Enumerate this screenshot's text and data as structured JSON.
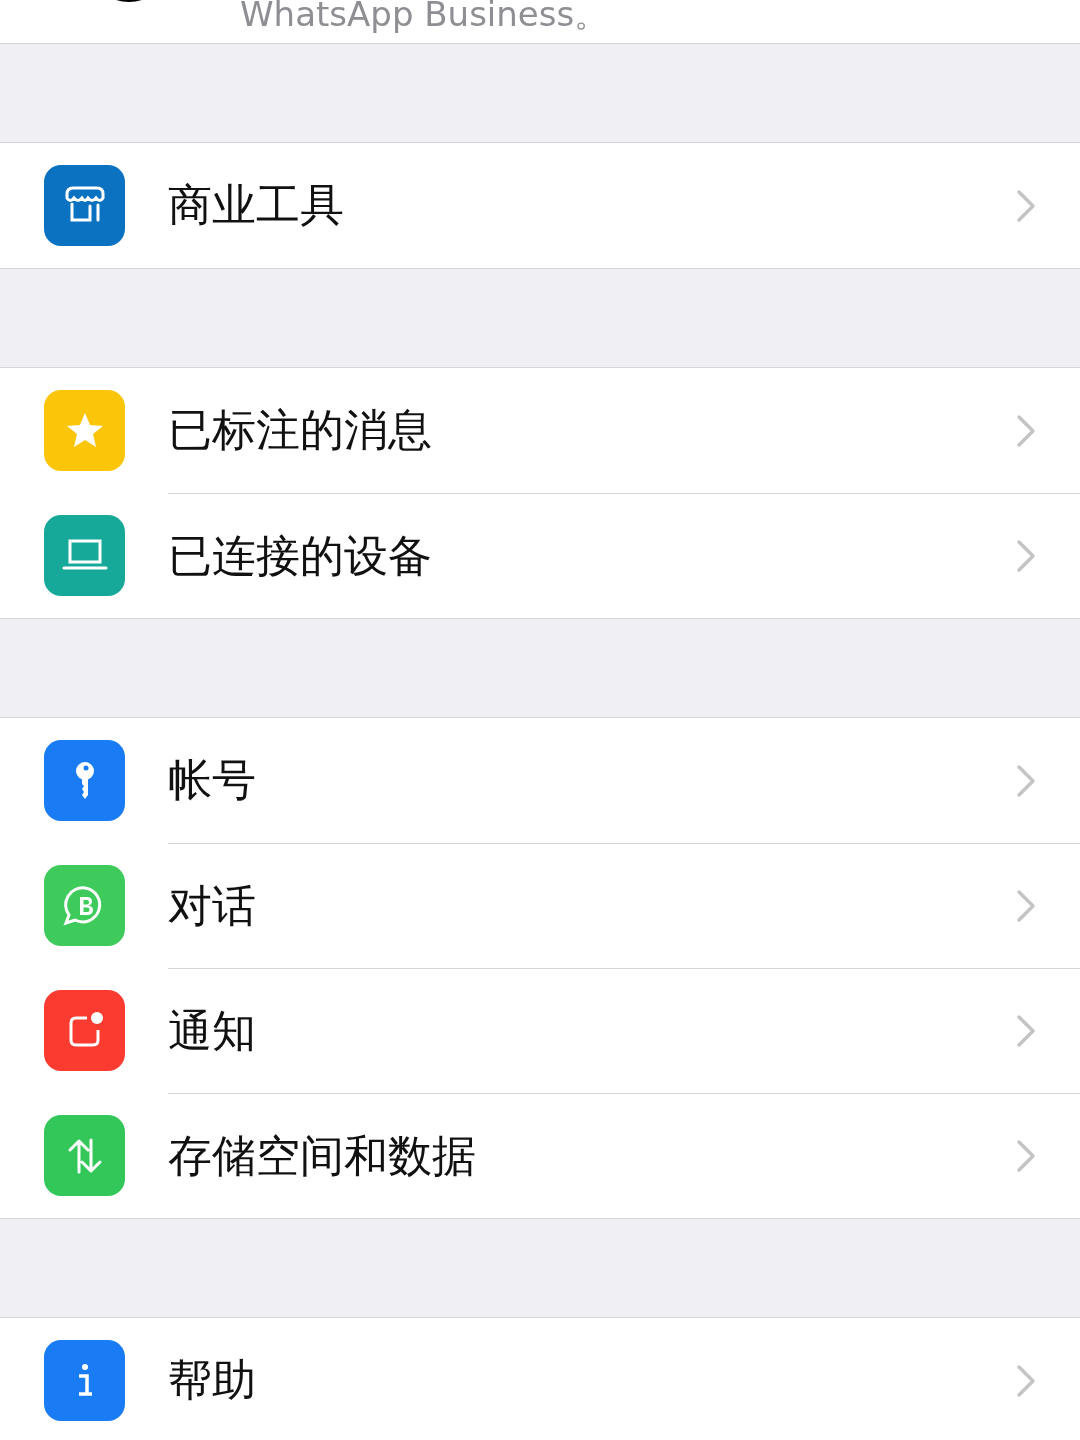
{
  "header": {
    "text": "WhatsApp Business。"
  },
  "groups": [
    {
      "items": [
        {
          "label": "商业工具",
          "kind": "store",
          "color": "#0a72c0"
        }
      ]
    },
    {
      "items": [
        {
          "label": "已标注的消息",
          "kind": "star",
          "color": "#fbc50a"
        },
        {
          "label": "已连接的设备",
          "kind": "laptop",
          "color": "#16a99a"
        }
      ]
    },
    {
      "items": [
        {
          "label": "帐号",
          "kind": "key",
          "color": "#1a7cf5"
        },
        {
          "label": "对话",
          "kind": "chat",
          "color": "#3fcb5c"
        },
        {
          "label": "通知",
          "kind": "notification",
          "color": "#fb3b30"
        },
        {
          "label": "存储空间和数据",
          "kind": "transfer",
          "color": "#33c759"
        }
      ]
    },
    {
      "items": [
        {
          "label": "帮助",
          "kind": "info",
          "color": "#1a7cf5"
        }
      ]
    }
  ]
}
